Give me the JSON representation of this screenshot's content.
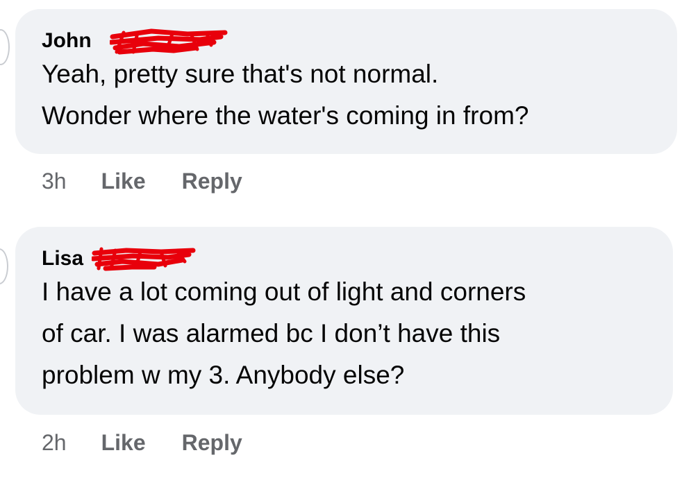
{
  "comments": [
    {
      "author": "John",
      "lines": [
        "Yeah, pretty sure that's not normal.",
        "Wonder where the water's coming in from?"
      ],
      "time": "3h",
      "like_label": "Like",
      "reply_label": "Reply"
    },
    {
      "author": "Lisa",
      "lines": [
        "I have a lot coming out of light and corners",
        "of car. I was alarmed bc I don’t have this",
        "problem w my 3. Anybody else?"
      ],
      "time": "2h",
      "like_label": "Like",
      "reply_label": "Reply"
    }
  ],
  "colors": {
    "bubble_bg": "#f0f2f5",
    "text_primary": "#050505",
    "text_secondary": "#65676b",
    "redaction": "#e8000b"
  }
}
